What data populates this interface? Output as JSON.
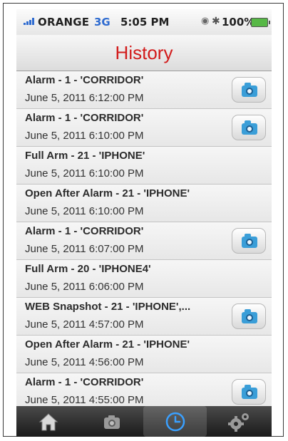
{
  "status_bar": {
    "carrier": "ORANGE",
    "network": "3G",
    "time": "5:05 PM",
    "battery": "100%"
  },
  "nav": {
    "title": "History"
  },
  "events": [
    {
      "title": "Alarm -  1 - 'CORRIDOR'",
      "datetime": "June 5, 2011 6:12:00 PM",
      "has_snapshot": true
    },
    {
      "title": "Alarm -  1 - 'CORRIDOR'",
      "datetime": "June 5, 2011 6:10:00 PM",
      "has_snapshot": true
    },
    {
      "title": "Full Arm -  21 - 'IPHONE'",
      "datetime": "June 5, 2011 6:10:00 PM",
      "has_snapshot": false
    },
    {
      "title": "Open After Alarm -  21 - 'IPHONE'",
      "datetime": "June 5, 2011 6:10:00 PM",
      "has_snapshot": false
    },
    {
      "title": "Alarm -  1 - 'CORRIDOR'",
      "datetime": "June 5, 2011 6:07:00 PM",
      "has_snapshot": true
    },
    {
      "title": "Full Arm -  20 - 'IPHONE4'",
      "datetime": "June 5, 2011 6:06:00 PM",
      "has_snapshot": false
    },
    {
      "title": "WEB Snapshot -  21 - 'IPHONE',...",
      "datetime": "June 5, 2011 4:57:00 PM",
      "has_snapshot": true
    },
    {
      "title": "Open After Alarm -  21 - 'IPHONE'",
      "datetime": "June 5, 2011 4:56:00 PM",
      "has_snapshot": false
    },
    {
      "title": "Alarm -  1 - 'CORRIDOR'",
      "datetime": "June 5, 2011 4:55:00 PM",
      "has_snapshot": true
    }
  ],
  "tabbar": {
    "tabs": [
      {
        "icon": "home-icon",
        "active": false
      },
      {
        "icon": "camera-icon",
        "active": false
      },
      {
        "icon": "clock-icon",
        "active": true
      },
      {
        "icon": "gears-icon",
        "active": false
      }
    ]
  },
  "colors": {
    "title": "#d21b1b",
    "network": "#2e6bd0",
    "camera": "#3a9ed8",
    "tab_active": "#3aa0ff"
  }
}
